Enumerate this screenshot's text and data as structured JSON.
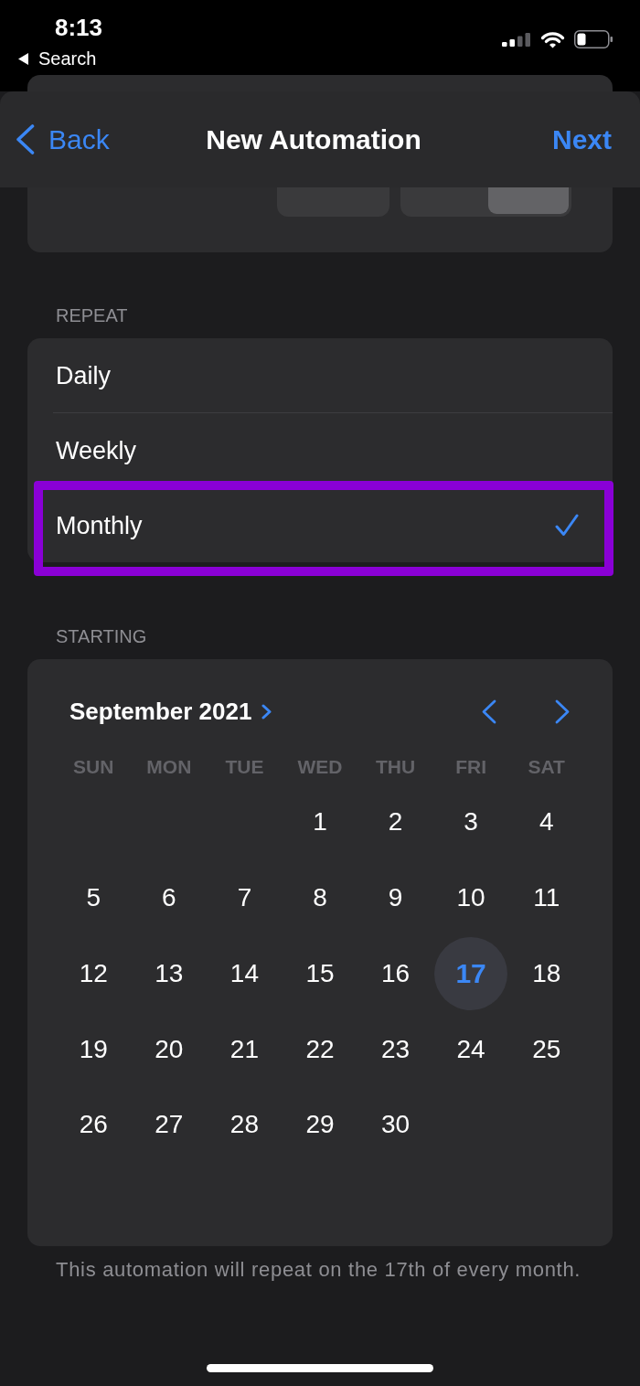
{
  "status_bar": {
    "time": "8:13",
    "return_label": "Search"
  },
  "nav_bar": {
    "back": "Back",
    "title": "New Automation",
    "next": "Next"
  },
  "time_picker": {
    "periods": [
      {
        "selected": false
      },
      {
        "selected": true
      }
    ]
  },
  "repeat": {
    "header": "REPEAT",
    "options": [
      {
        "label": "Daily",
        "selected": false,
        "highlighted": false
      },
      {
        "label": "Weekly",
        "selected": false,
        "highlighted": false
      },
      {
        "label": "Monthly",
        "selected": true,
        "highlighted": true
      }
    ]
  },
  "starting": {
    "header": "STARTING",
    "calendar": {
      "month": "September 2021",
      "weekdays": [
        "SUN",
        "MON",
        "TUE",
        "WED",
        "THU",
        "FRI",
        "SAT"
      ],
      "weeks": [
        {
          "kind": "first",
          "days": [
            {
              "label": "1",
              "selected": false
            },
            {
              "label": "2",
              "selected": false
            },
            {
              "label": "3",
              "selected": false
            },
            {
              "label": "4",
              "selected": false
            }
          ]
        },
        {
          "kind": "full",
          "days": [
            {
              "label": "5",
              "selected": false
            },
            {
              "label": "6",
              "selected": false
            },
            {
              "label": "7",
              "selected": false
            },
            {
              "label": "8",
              "selected": false
            },
            {
              "label": "9",
              "selected": false
            },
            {
              "label": "10",
              "selected": false
            },
            {
              "label": "11",
              "selected": false
            }
          ]
        },
        {
          "kind": "full",
          "days": [
            {
              "label": "12",
              "selected": false
            },
            {
              "label": "13",
              "selected": false
            },
            {
              "label": "14",
              "selected": false
            },
            {
              "label": "15",
              "selected": false
            },
            {
              "label": "16",
              "selected": false
            },
            {
              "label": "17",
              "selected": true
            },
            {
              "label": "18",
              "selected": false
            }
          ]
        },
        {
          "kind": "full",
          "days": [
            {
              "label": "19",
              "selected": false
            },
            {
              "label": "20",
              "selected": false
            },
            {
              "label": "21",
              "selected": false
            },
            {
              "label": "22",
              "selected": false
            },
            {
              "label": "23",
              "selected": false
            },
            {
              "label": "24",
              "selected": false
            },
            {
              "label": "25",
              "selected": false
            }
          ]
        },
        {
          "kind": "last",
          "days": [
            {
              "label": "26",
              "selected": false
            },
            {
              "label": "27",
              "selected": false
            },
            {
              "label": "28",
              "selected": false
            },
            {
              "label": "29",
              "selected": false
            },
            {
              "label": "30",
              "selected": false
            }
          ]
        }
      ]
    }
  },
  "footer": "This automation will repeat on the 17th of every month."
}
